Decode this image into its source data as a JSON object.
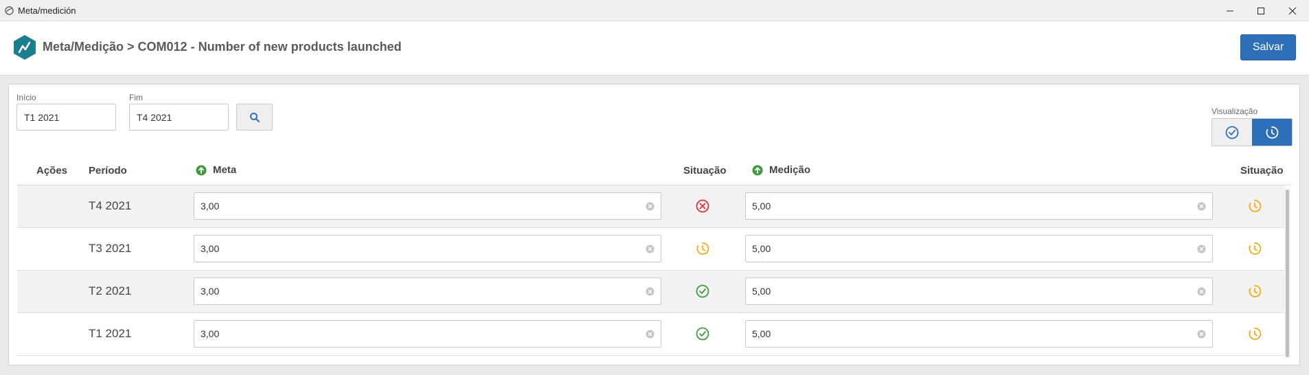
{
  "window": {
    "title": "Meta/medición"
  },
  "header": {
    "breadcrumb": "Meta/Medição > COM012 - Number of new products launched",
    "save_label": "Salvar"
  },
  "filters": {
    "start_label": "Início",
    "start_value": "T1 2021",
    "end_label": "Fim",
    "end_value": "T4 2021",
    "visualization_label": "Visualização"
  },
  "table": {
    "columns": {
      "actions": "Ações",
      "period": "Período",
      "goal": "Meta",
      "goal_status": "Situação",
      "measurement": "Medição",
      "measurement_status": "Situação"
    },
    "rows": [
      {
        "period": "T4 2021",
        "goal": "3,00",
        "goal_status": "failed-icon",
        "measurement": "5,00",
        "measurement_status": "pending-clock-icon"
      },
      {
        "period": "T3 2021",
        "goal": "3,00",
        "goal_status": "pending-clock-icon",
        "measurement": "5,00",
        "measurement_status": "pending-clock-icon"
      },
      {
        "period": "T2 2021",
        "goal": "3,00",
        "goal_status": "success-check-icon",
        "measurement": "5,00",
        "measurement_status": "pending-clock-icon"
      },
      {
        "period": "T1 2021",
        "goal": "3,00",
        "goal_status": "success-check-icon",
        "measurement": "5,00",
        "measurement_status": "pending-clock-icon"
      }
    ]
  },
  "colors": {
    "primary": "#2e6fba",
    "success": "#3f9a3f",
    "danger": "#e0303a",
    "warning": "#f2ab14",
    "logo": "#1a7e8c"
  }
}
